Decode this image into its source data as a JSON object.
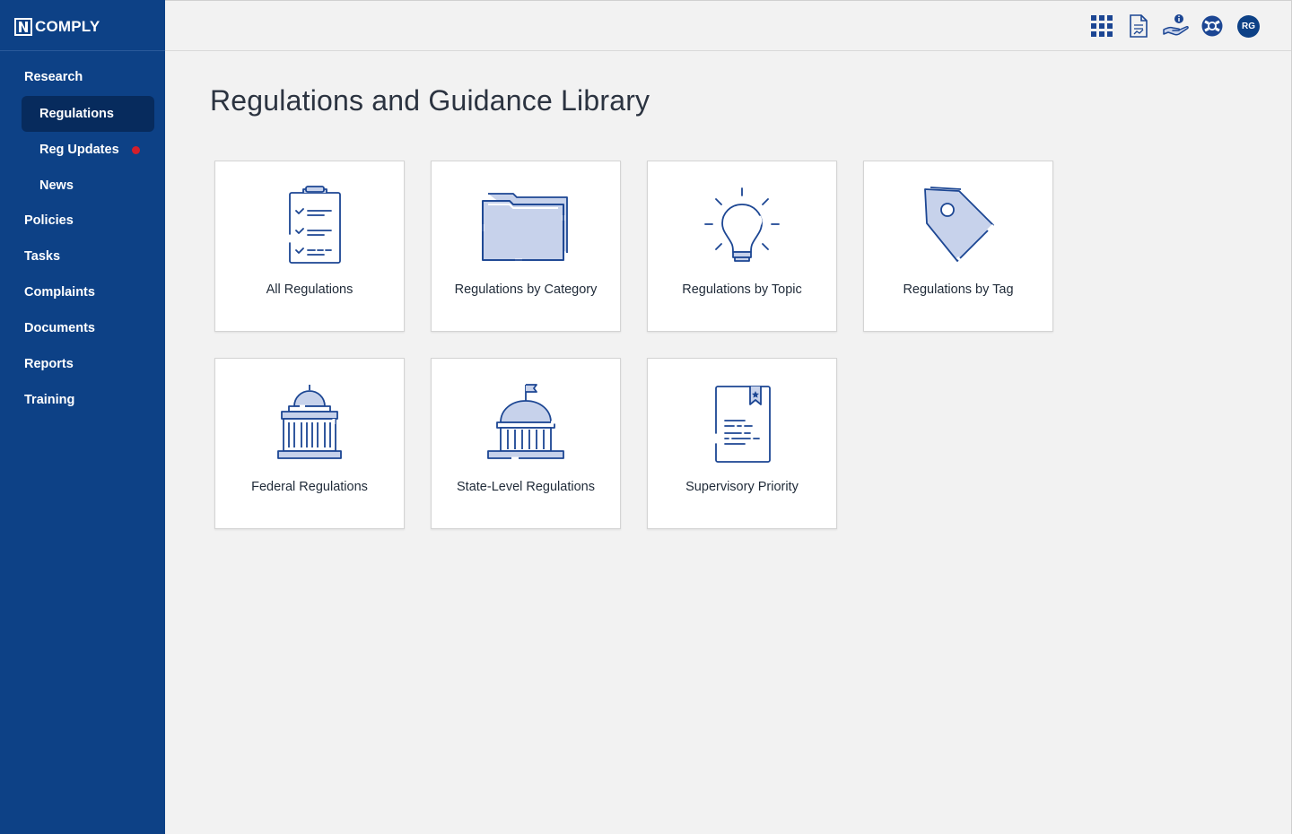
{
  "app": {
    "logo_text": "COMPLY",
    "logo_mark_icon": "n-logo-icon"
  },
  "sidebar": {
    "section_research": "Research",
    "sub_items": [
      {
        "label": "Regulations",
        "active": true
      },
      {
        "label": "Reg Updates",
        "has_dot": true
      },
      {
        "label": "News"
      }
    ],
    "items": [
      "Policies",
      "Tasks",
      "Complaints",
      "Documents",
      "Reports",
      "Training"
    ]
  },
  "topbar": {
    "icons": [
      "apps-grid-icon",
      "document-chart-icon",
      "hand-info-icon",
      "lifebuoy-icon"
    ],
    "avatar_initials": "RG"
  },
  "main": {
    "title": "Regulations and Guidance Library",
    "cards": [
      {
        "label": "All Regulations",
        "icon": "clipboard-checklist-icon"
      },
      {
        "label": "Regulations by Category",
        "icon": "folder-icon"
      },
      {
        "label": "Regulations by Topic",
        "icon": "lightbulb-icon"
      },
      {
        "label": "Regulations by Tag",
        "icon": "tag-icon"
      },
      {
        "label": "Federal Regulations",
        "icon": "capitol-building-icon"
      },
      {
        "label": "State-Level Regulations",
        "icon": "state-building-icon"
      },
      {
        "label": "Supervisory Priority",
        "icon": "bookmarked-document-icon"
      }
    ]
  },
  "colors": {
    "sidebar_bg": "#0d4186",
    "active_bg": "#072b5d",
    "icon_stroke": "#1c4693",
    "icon_fill": "#c7d2eb",
    "alert_dot": "#d21f2b"
  }
}
